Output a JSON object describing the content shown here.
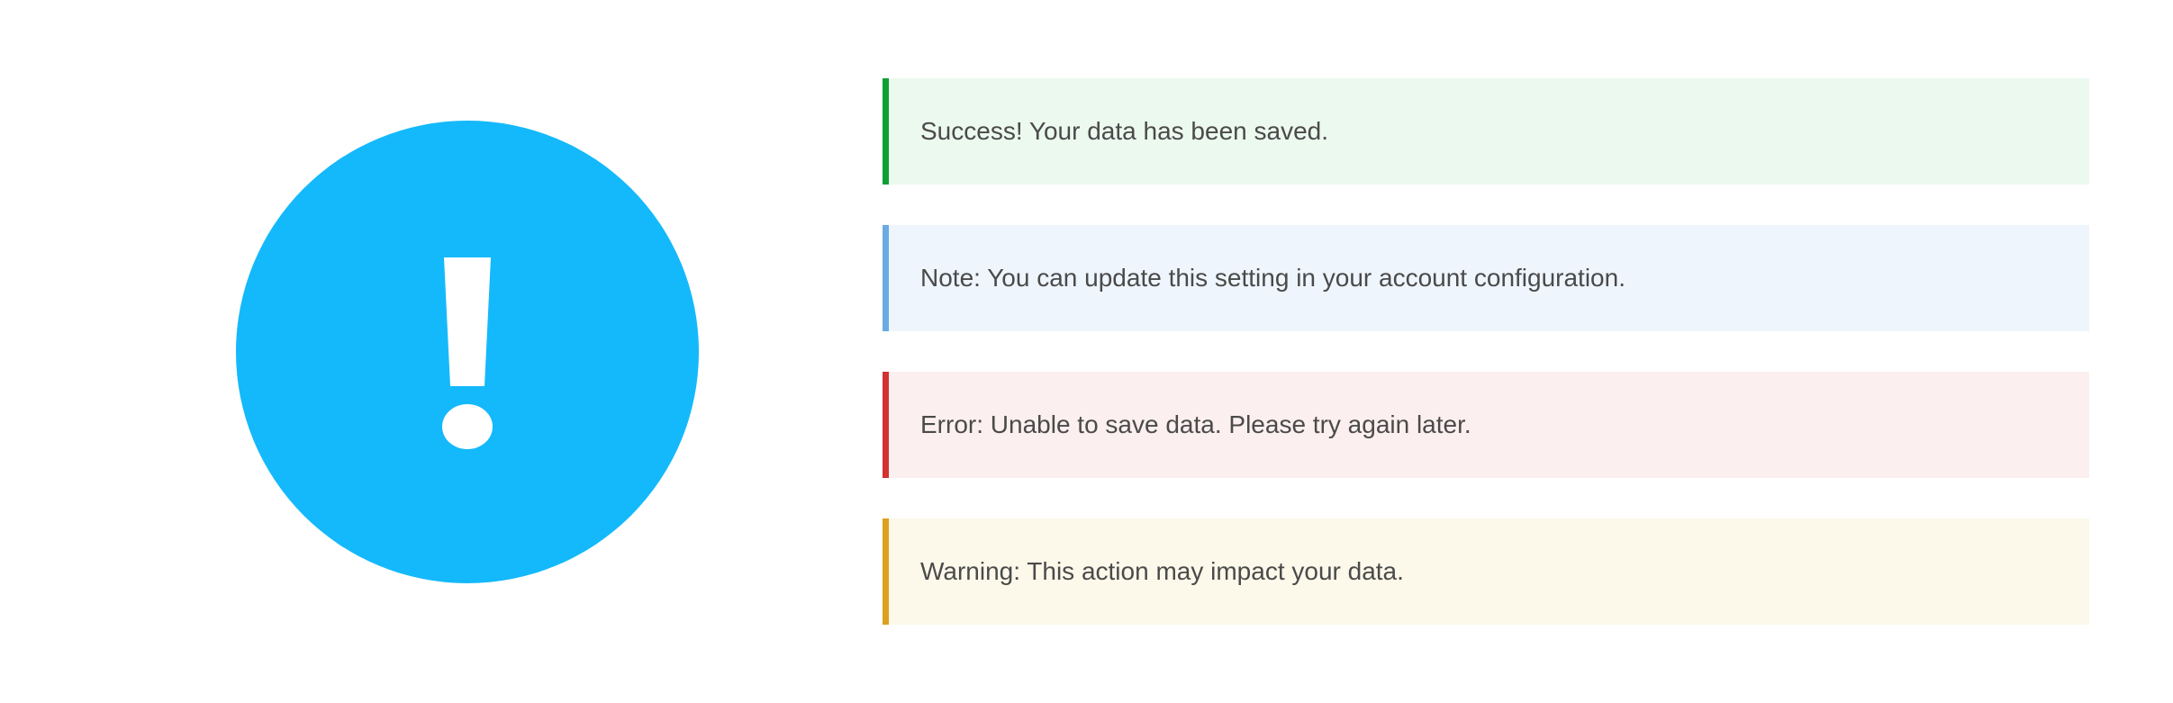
{
  "icon": {
    "name": "exclamation-icon",
    "color": "#14b9fb",
    "glyph_color": "#ffffff"
  },
  "alerts": [
    {
      "type": "success",
      "text": "Success! Your data has been saved.",
      "background": "#ecf9ef",
      "border": "#0e9f35"
    },
    {
      "type": "note",
      "text": "Note: You can update this setting in your account configuration.",
      "background": "#eef5fd",
      "border": "#6aaae3"
    },
    {
      "type": "error",
      "text": "Error: Unable to save data. Please try again later.",
      "background": "#fcefef",
      "border": "#d23232"
    },
    {
      "type": "warning",
      "text": "Warning: This action may impact your data.",
      "background": "#fcf8ea",
      "border": "#dba11f"
    }
  ]
}
